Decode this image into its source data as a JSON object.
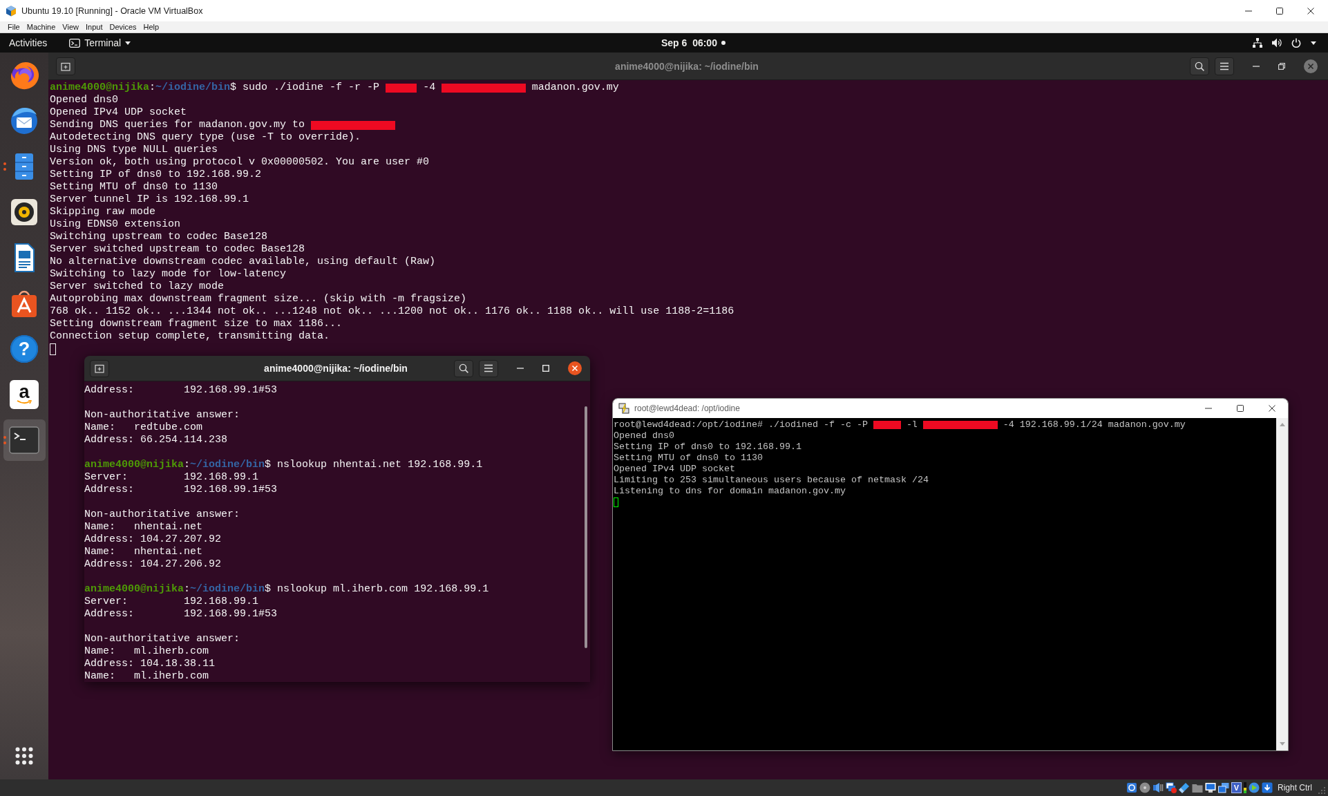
{
  "vbox_window": {
    "title": "Ubuntu 19.10 [Running] - Oracle VM VirtualBox"
  },
  "menu_bar": [
    "File",
    "Machine",
    "View",
    "Input",
    "Devices",
    "Help"
  ],
  "top_bar": {
    "activities": "Activities",
    "app_menu": "Terminal",
    "clock": "Sep 6  06:00",
    "notification": true
  },
  "dock": [
    {
      "kind": "globe",
      "running": false,
      "focused": false
    },
    {
      "kind": "mail",
      "running": false,
      "focused": false
    },
    {
      "kind": "cabinet",
      "running": true,
      "focused": false
    },
    {
      "kind": "speaker",
      "running": false,
      "focused": false
    },
    {
      "kind": "document",
      "running": false,
      "focused": false
    },
    {
      "kind": "bag",
      "running": false,
      "focused": false
    },
    {
      "kind": "help",
      "glyph": "?",
      "running": false,
      "focused": false
    },
    {
      "kind": "shop",
      "glyph": "a",
      "running": false,
      "focused": false
    },
    {
      "kind": "terminal",
      "running": true,
      "focused": true
    }
  ],
  "terminals": [
    {
      "kind": "gnome",
      "title": "anime4000@nijika: ~/iodine/bin",
      "focused": false,
      "maximized": true,
      "scrollable": false,
      "lines": [
        {
          "kind": "prompt",
          "user": "anime4000@nijika",
          "sep": ":",
          "path": "~/iodine/bin",
          "sigil": "$",
          "parts": [
            {
              "kind": "text",
              "text": "sudo ./iodine -f -r -P"
            },
            {
              "kind": "short-redaction"
            },
            {
              "kind": "text",
              "text": "-4"
            },
            {
              "kind": "long-redaction"
            },
            {
              "kind": "text",
              "text": "madanon.gov.my"
            }
          ]
        },
        {
          "kind": "output",
          "text": "Opened dns0"
        },
        {
          "kind": "output",
          "text": "Opened IPv4 UDP socket"
        },
        {
          "kind": "output",
          "parts": [
            {
              "kind": "text",
              "text": "Sending DNS queries for madanon.gov.my to"
            },
            {
              "kind": "long-redaction"
            }
          ]
        },
        {
          "kind": "output",
          "text": "Autodetecting DNS query type (use -T to override)."
        },
        {
          "kind": "output",
          "text": "Using DNS type NULL queries"
        },
        {
          "kind": "output",
          "text": "Version ok, both using protocol v 0x00000502. You are user #0"
        },
        {
          "kind": "output",
          "text": "Setting IP of dns0 to 192.168.99.2"
        },
        {
          "kind": "output",
          "text": "Setting MTU of dns0 to 1130"
        },
        {
          "kind": "output",
          "text": "Server tunnel IP is 192.168.99.1"
        },
        {
          "kind": "output",
          "text": "Skipping raw mode"
        },
        {
          "kind": "output",
          "text": "Using EDNS0 extension"
        },
        {
          "kind": "output",
          "text": "Switching upstream to codec Base128"
        },
        {
          "kind": "output",
          "text": "Server switched upstream to codec Base128"
        },
        {
          "kind": "output",
          "text": "No alternative downstream codec available, using default (Raw)"
        },
        {
          "kind": "output",
          "text": "Switching to lazy mode for low-latency"
        },
        {
          "kind": "output",
          "text": "Server switched to lazy mode"
        },
        {
          "kind": "output",
          "text": "Autoprobing max downstream fragment size... (skip with -m fragsize)"
        },
        {
          "kind": "output",
          "text": "768 ok.. 1152 ok.. ...1344 not ok.. ...1248 not ok.. ...1200 not ok.. 1176 ok.. 1188 ok.. will use 1188-2=1186"
        },
        {
          "kind": "output",
          "text": "Setting downstream fragment size to max 1186..."
        },
        {
          "kind": "output",
          "text": "Connection setup complete, transmitting data."
        },
        {
          "kind": "cursor"
        }
      ]
    },
    {
      "kind": "gnome",
      "title": "anime4000@nijika: ~/iodine/bin",
      "focused": true,
      "maximized": false,
      "scrollable": true,
      "lines": [
        {
          "kind": "output",
          "text": "Address:        192.168.99.1#53"
        },
        {
          "kind": "blank"
        },
        {
          "kind": "output",
          "text": "Non-authoritative answer:"
        },
        {
          "kind": "output",
          "text": "Name:   redtube.com"
        },
        {
          "kind": "output",
          "text": "Address: 66.254.114.238"
        },
        {
          "kind": "blank"
        },
        {
          "kind": "prompt",
          "user": "anime4000@nijika",
          "sep": ":",
          "path": "~/iodine/bin",
          "sigil": "$",
          "command": "nslookup nhentai.net 192.168.99.1"
        },
        {
          "kind": "output",
          "text": "Server:         192.168.99.1"
        },
        {
          "kind": "output",
          "text": "Address:        192.168.99.1#53"
        },
        {
          "kind": "blank"
        },
        {
          "kind": "output",
          "text": "Non-authoritative answer:"
        },
        {
          "kind": "output",
          "text": "Name:   nhentai.net"
        },
        {
          "kind": "output",
          "text": "Address: 104.27.207.92"
        },
        {
          "kind": "output",
          "text": "Name:   nhentai.net"
        },
        {
          "kind": "output",
          "text": "Address: 104.27.206.92"
        },
        {
          "kind": "blank"
        },
        {
          "kind": "prompt",
          "user": "anime4000@nijika",
          "sep": ":",
          "path": "~/iodine/bin",
          "sigil": "$",
          "command": "nslookup ml.iherb.com 192.168.99.1"
        },
        {
          "kind": "output",
          "text": "Server:         192.168.99.1"
        },
        {
          "kind": "output",
          "text": "Address:        192.168.99.1#53"
        },
        {
          "kind": "blank"
        },
        {
          "kind": "output",
          "text": "Non-authoritative answer:"
        },
        {
          "kind": "output",
          "text": "Name:   ml.iherb.com"
        },
        {
          "kind": "output",
          "text": "Address: 104.18.38.11"
        },
        {
          "kind": "output",
          "text": "Name:   ml.iherb.com"
        }
      ]
    },
    {
      "kind": "putty",
      "title": "root@lewd4dead: /opt/iodine",
      "focused": false,
      "maximized": false,
      "scrollable": true,
      "lines": [
        {
          "kind": "output",
          "parts": [
            {
              "kind": "text",
              "text": "root@lewd4dead:/opt/iodine# ./iodined -f -c -P"
            },
            {
              "kind": "short-redaction"
            },
            {
              "kind": "text",
              "text": "-l"
            },
            {
              "kind": "long-redaction"
            },
            {
              "kind": "text",
              "text": "-4 192.168.99.1/24 madanon.gov.my"
            }
          ]
        },
        {
          "kind": "output",
          "text": "Opened dns0"
        },
        {
          "kind": "output",
          "text": "Setting IP of dns0 to 192.168.99.1"
        },
        {
          "kind": "output",
          "text": "Setting MTU of dns0 to 1130"
        },
        {
          "kind": "output",
          "text": "Opened IPv4 UDP socket"
        },
        {
          "kind": "output",
          "text": "Limiting to 253 simultaneous users because of netmask /24"
        },
        {
          "kind": "output",
          "text": "Listening to dns for domain madanon.gov.my"
        },
        {
          "kind": "cursor"
        }
      ]
    }
  ],
  "status_bar": {
    "indicators": [
      {
        "kind": "hard-disk"
      },
      {
        "kind": "optical-drive"
      },
      {
        "kind": "audio"
      },
      {
        "kind": "network"
      },
      {
        "kind": "usb"
      },
      {
        "kind": "shared-folders"
      },
      {
        "kind": "display"
      },
      {
        "kind": "recording"
      },
      {
        "kind": "engine",
        "glyph": "V"
      },
      {
        "kind": "mouse"
      },
      {
        "kind": "keyboard"
      }
    ],
    "host_key": "Right Ctrl"
  }
}
